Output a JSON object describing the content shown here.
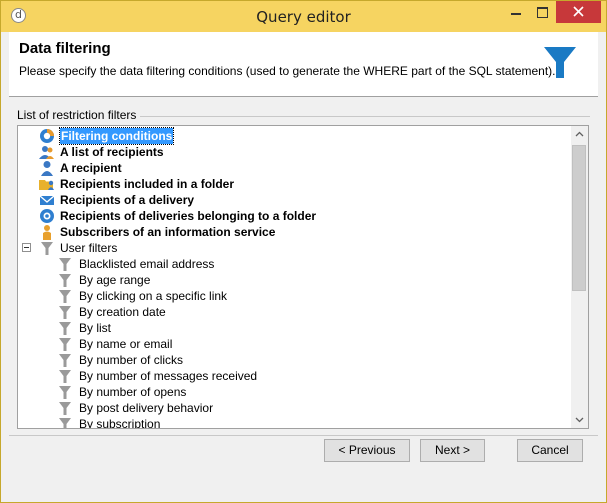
{
  "window": {
    "title": "Query editor"
  },
  "header": {
    "title": "Data filtering",
    "subtitle": "Please specify the data filtering conditions (used to generate the WHERE part of the SQL statement).",
    "icon": "funnel-icon"
  },
  "filters_group": {
    "label": "List of restriction filters",
    "items": [
      {
        "label": "Filtering conditions",
        "icon": "filtering-conditions-icon",
        "bold": true,
        "selected": true
      },
      {
        "label": "A list of recipients",
        "icon": "recipient-list-icon",
        "bold": true
      },
      {
        "label": "A recipient",
        "icon": "recipient-icon",
        "bold": true
      },
      {
        "label": "Recipients included in a folder",
        "icon": "folder-recipients-icon",
        "bold": true
      },
      {
        "label": "Recipients of a delivery",
        "icon": "delivery-envelope-icon",
        "bold": true
      },
      {
        "label": "Recipients of deliveries belonging to a folder",
        "icon": "delivery-folder-icon",
        "bold": true
      },
      {
        "label": "Subscribers of an information service",
        "icon": "subscriber-icon",
        "bold": true
      },
      {
        "label": "User filters",
        "icon": "funnel-icon",
        "expanded": true,
        "children": [
          {
            "label": "Blacklisted email address"
          },
          {
            "label": "By age range"
          },
          {
            "label": "By clicking on a specific link"
          },
          {
            "label": "By creation date"
          },
          {
            "label": "By list"
          },
          {
            "label": "By name or email"
          },
          {
            "label": "By number of clicks"
          },
          {
            "label": "By number of messages received"
          },
          {
            "label": "By number of opens"
          },
          {
            "label": "By post delivery behavior"
          },
          {
            "label": "By subscription"
          }
        ]
      }
    ]
  },
  "buttons": {
    "previous": "< Previous",
    "next": "Next >",
    "cancel": "Cancel"
  },
  "colors": {
    "titlebar": "#f6d461",
    "selection": "#3399ff",
    "close_button": "#c7383a",
    "funnel": "#1a7ac4"
  }
}
